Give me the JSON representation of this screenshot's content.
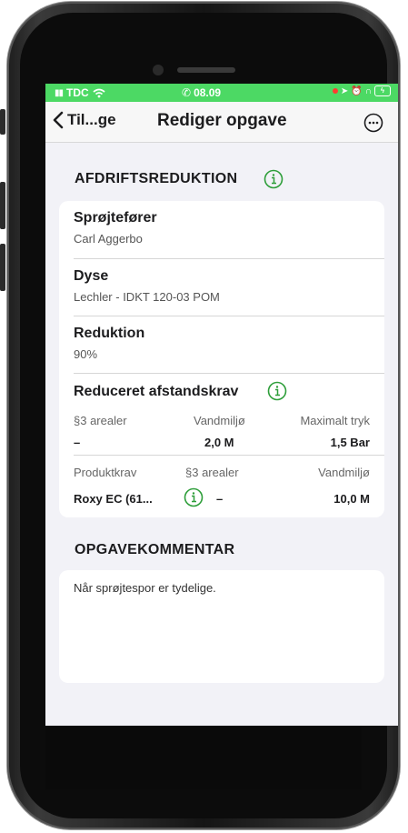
{
  "status_bar": {
    "carrier": "TDC",
    "time": "08.09"
  },
  "nav": {
    "back_label": "Til...ge",
    "title": "Rediger opgave"
  },
  "afdrift": {
    "section_title": "AFDRIFTSREDUKTION",
    "sprojtefoerer_label": "Sprøjtefører",
    "sprojtefoerer_value": "Carl Aggerbo",
    "dyse_label": "Dyse",
    "dyse_value": "Lechler - IDKT 120-03 POM",
    "reduktion_label": "Reduktion",
    "reduktion_value": "90%",
    "afstandskrav_label": "Reduceret afstandskrav",
    "row1_headers": [
      "§3 arealer",
      "Vandmiljø",
      "Maximalt tryk"
    ],
    "row1_values": [
      "–",
      "2,0 M",
      "1,5 Bar"
    ],
    "row2_headers": [
      "Produktkrav",
      "§3 arealer",
      "Vandmiljø"
    ],
    "row2_values": [
      "Roxy EC (61...",
      "–",
      "10,0 M"
    ]
  },
  "kommentar": {
    "section_title": "OPGAVEKOMMENTAR",
    "text": "Når sprøjtespor er tydelige."
  },
  "colors": {
    "status_green": "#4cd964",
    "info_green": "#2e9e3a",
    "background": "#f2f2f7"
  },
  "icons": {
    "back": "chevron-left-icon",
    "more": "ellipsis-circle-icon",
    "info": "info-circle-icon"
  }
}
